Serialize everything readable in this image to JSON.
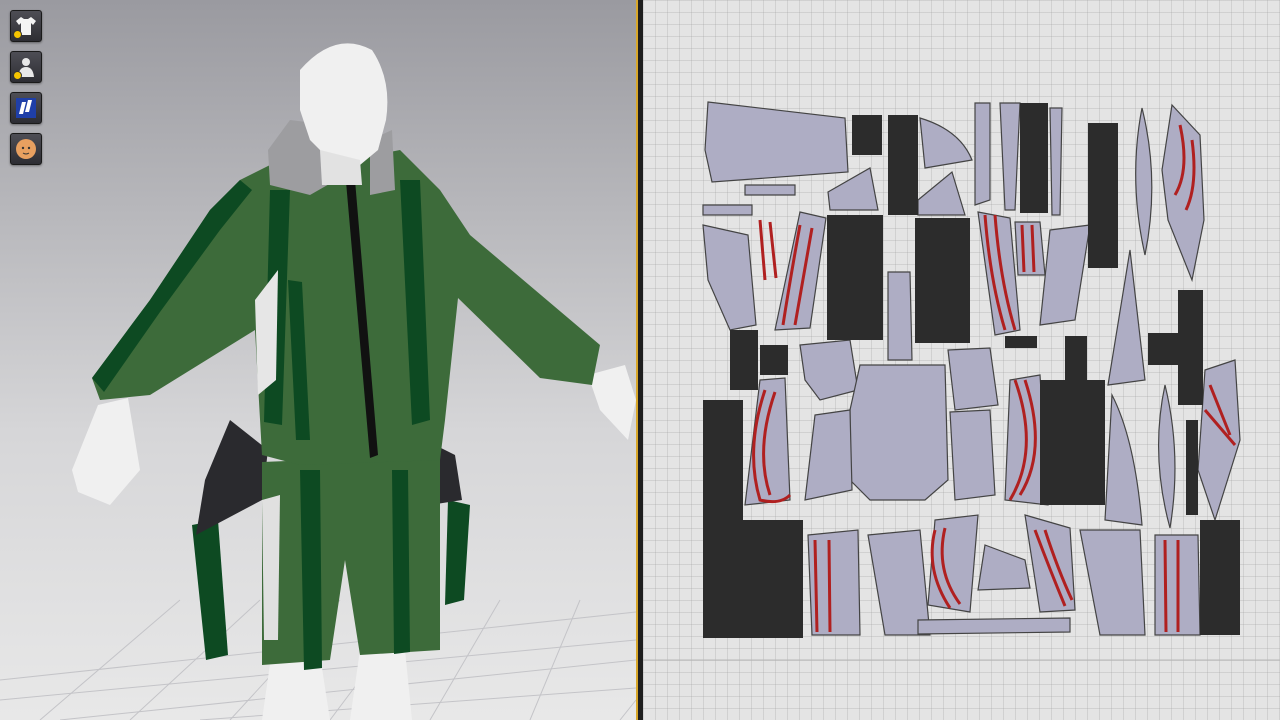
{
  "toolbar": {
    "buttons": [
      {
        "icon": "garment-icon",
        "has_indicator": true
      },
      {
        "icon": "avatar-icon",
        "has_indicator": true
      },
      {
        "icon": "texture-icon",
        "has_indicator": false
      },
      {
        "icon": "face-icon",
        "has_indicator": false
      }
    ]
  },
  "colors": {
    "garment_green": "#3d6b3a",
    "trim_dark_green": "#0d4a22",
    "avatar": "#f2f2f2",
    "pattern_fill": "#aeadc4",
    "internal_line": "#b02020",
    "accent_divider": "#d8a72a"
  },
  "views": {
    "left": "3d-view",
    "right": "2d-pattern-view"
  }
}
